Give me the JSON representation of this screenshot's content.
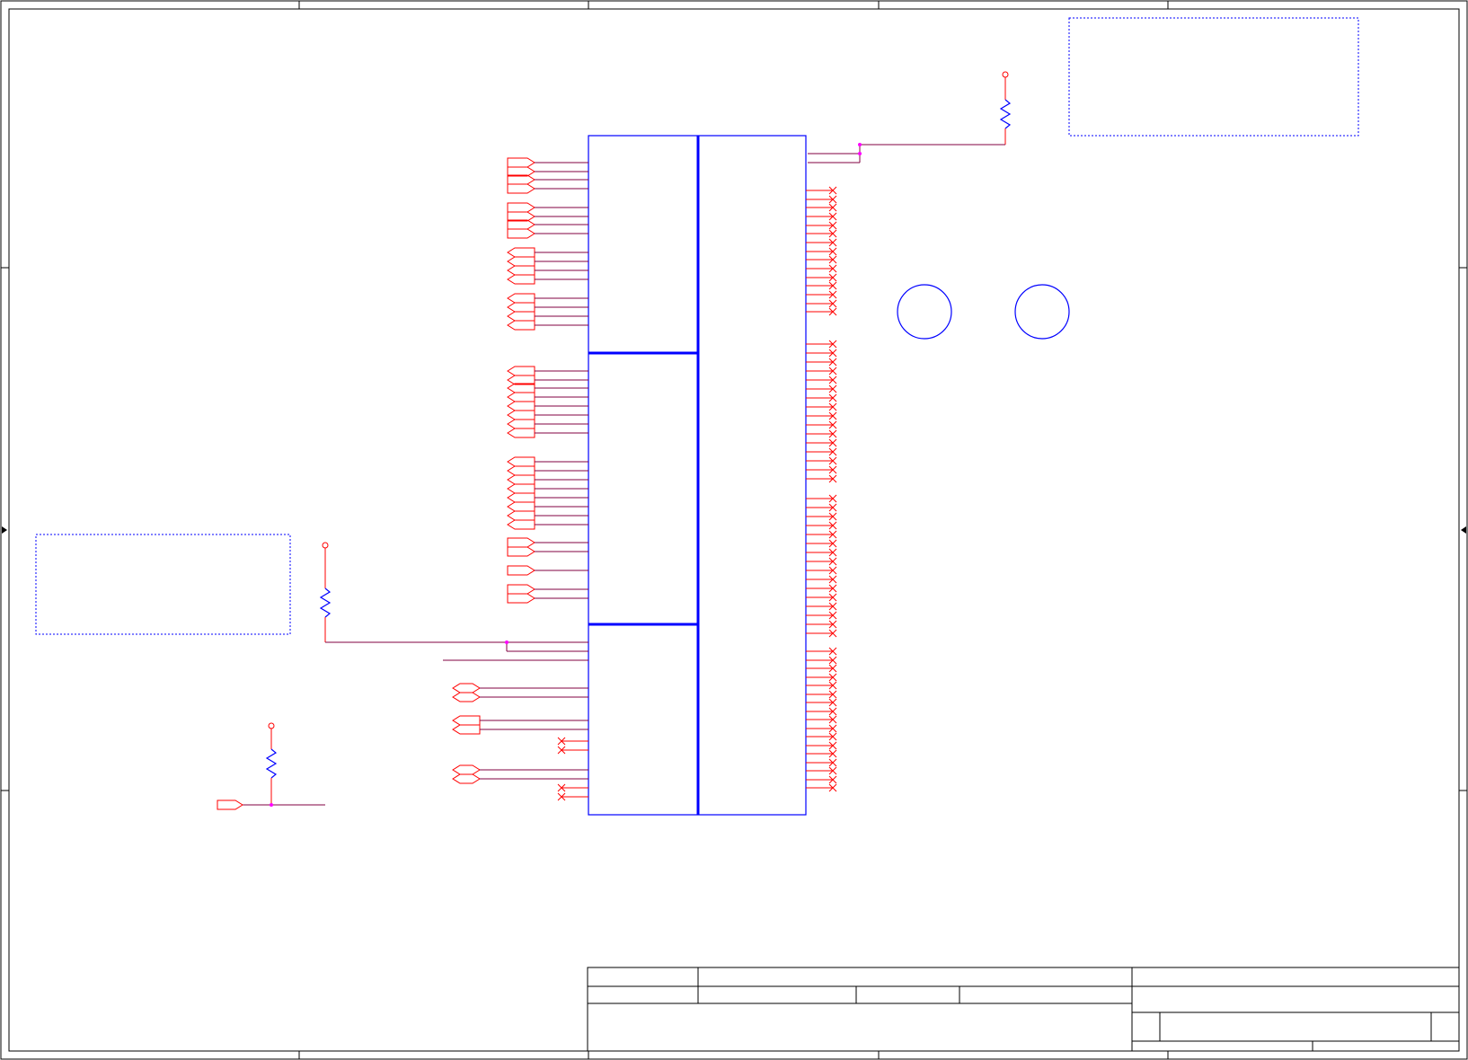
{
  "colors": {
    "frame": "#000000",
    "component": "#0000ff",
    "pin": "#ff0000",
    "wire": "#800040",
    "junction": "#ff00ff",
    "note_border": "#0000ff",
    "background": "#ffffff"
  },
  "icon_names": {
    "resistor": "resistor-icon",
    "power_port": "power-port-icon",
    "net_port": "net-port-icon",
    "no_connect": "no-connect-icon",
    "junction": "junction-dot-icon",
    "mounting_hole": "mounting-hole-icon",
    "grid_arrow": "grid-arrow-icon"
  }
}
